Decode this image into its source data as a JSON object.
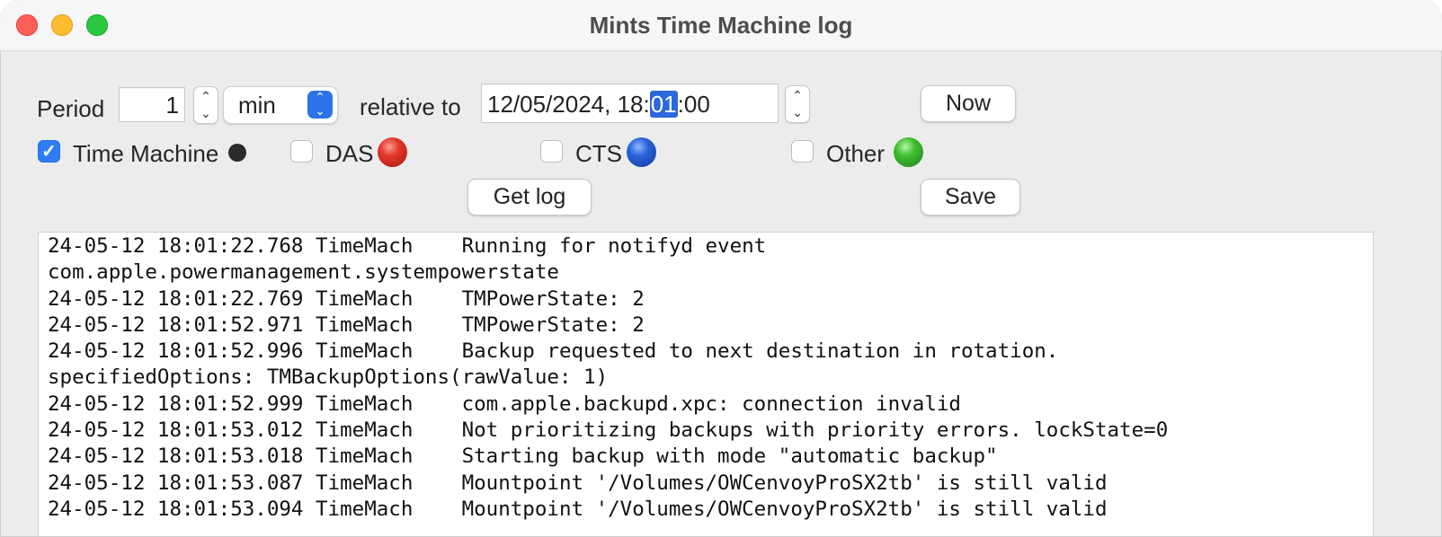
{
  "window": {
    "title": "Mints Time Machine log"
  },
  "controls": {
    "period_label": "Period",
    "period_value": "1",
    "unit_selected": "min",
    "relative_label": "relative to",
    "datetime_prefix": "12/05/2024, 18:",
    "datetime_selected": "01",
    "datetime_suffix": ":00",
    "now_button": "Now",
    "get_log_button": "Get log",
    "save_button": "Save"
  },
  "filters": [
    {
      "label": "Time Machine",
      "checked": true,
      "color": "#2b2b2b"
    },
    {
      "label": "DAS",
      "checked": false,
      "color": "#d8251d"
    },
    {
      "label": "CTS",
      "checked": false,
      "color": "#1f56cf"
    },
    {
      "label": "Other",
      "checked": false,
      "color": "#39b92b"
    }
  ],
  "colors": {
    "accent": "#2f7df6",
    "selection": "#2b68d9"
  },
  "log": {
    "lines": [
      "24-05-12 18:01:22.768 TimeMach    Running for notifyd event",
      "com.apple.powermanagement.systempowerstate",
      "24-05-12 18:01:22.769 TimeMach    TMPowerState: 2",
      "24-05-12 18:01:52.971 TimeMach    TMPowerState: 2",
      "24-05-12 18:01:52.996 TimeMach    Backup requested to next destination in rotation.",
      "specifiedOptions: TMBackupOptions(rawValue: 1)",
      "24-05-12 18:01:52.999 TimeMach    com.apple.backupd.xpc: connection invalid",
      "24-05-12 18:01:53.012 TimeMach    Not prioritizing backups with priority errors. lockState=0",
      "24-05-12 18:01:53.018 TimeMach    Starting backup with mode \"automatic backup\"",
      "24-05-12 18:01:53.087 TimeMach    Mountpoint '/Volumes/OWCenvoyProSX2tb' is still valid",
      "24-05-12 18:01:53.094 TimeMach    Mountpoint '/Volumes/OWCenvoyProSX2tb' is still valid"
    ]
  }
}
